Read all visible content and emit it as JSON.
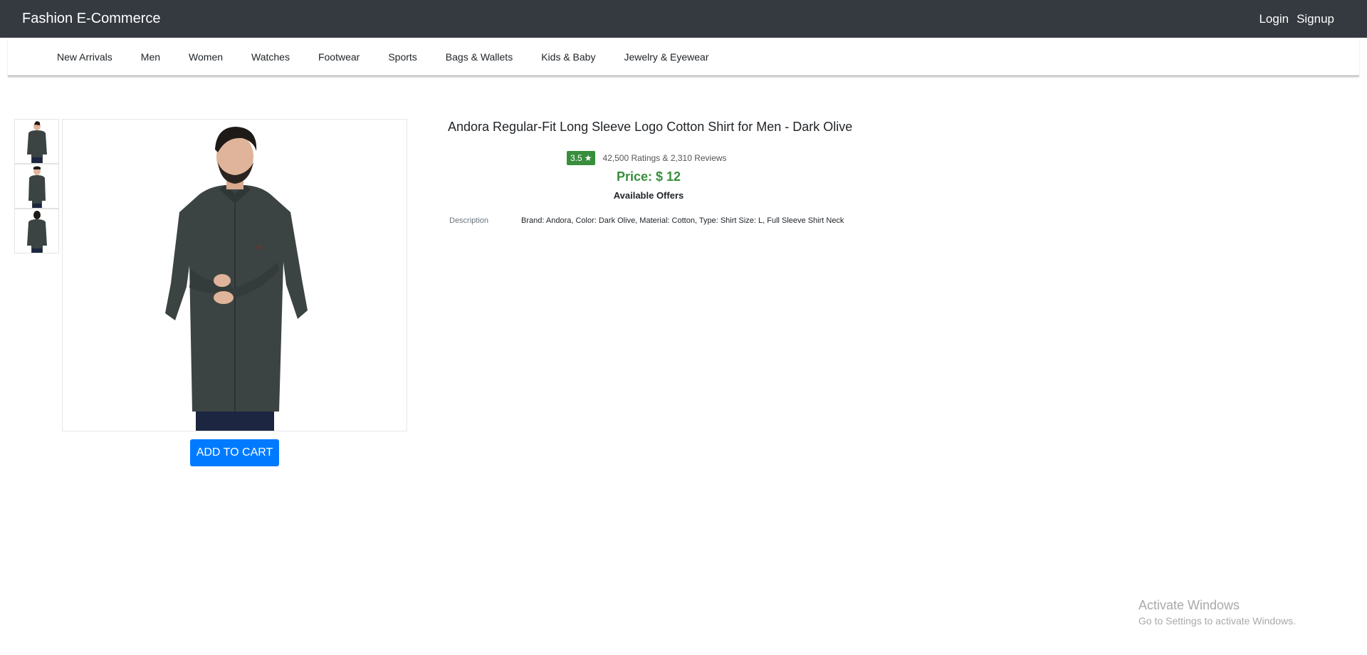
{
  "navbar": {
    "brand": "Fashion E-Commerce",
    "login_label": "Login",
    "signup_label": "Signup"
  },
  "categories": [
    "New Arrivals",
    "Men",
    "Women",
    "Watches",
    "Footwear",
    "Sports",
    "Bags & Wallets",
    "Kids & Baby",
    "Jewelry & Eyewear"
  ],
  "product": {
    "title": "Andora Regular-Fit Long Sleeve Logo Cotton Shirt for Men - Dark Olive",
    "rating": "3.5",
    "rating_icon": "star-icon",
    "ratings_reviews": "42,500 Ratings & 2,310 Reviews",
    "price": "Price: $ 12",
    "offers_label": "Available Offers",
    "description_label": "Description",
    "description": "Brand: Andora, Color: Dark Olive, Material: Cotton, Type: Shirt Size: L, Full Sleeve Shirt Neck",
    "thumbnails": [
      "shirt-front-thumbnail",
      "shirt-angle-thumbnail",
      "shirt-back-thumbnail"
    ],
    "add_to_cart_label": "ADD TO CART"
  },
  "colors": {
    "navbar_bg": "#343a40",
    "rating_green": "#388e3c",
    "button_blue": "#007bff",
    "shirt": "#3b4442"
  },
  "watermark": {
    "title": "Activate Windows",
    "subtitle": "Go to Settings to activate Windows."
  }
}
